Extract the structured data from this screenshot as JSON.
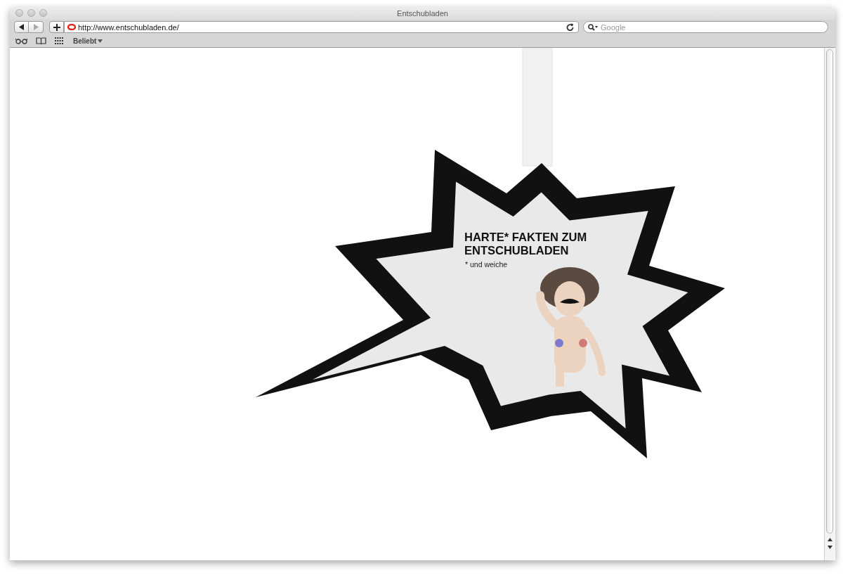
{
  "window": {
    "title": "Entschubladen"
  },
  "nav": [
    {
      "kind": "back",
      "disabled": false
    },
    {
      "kind": "forward",
      "disabled": true
    }
  ],
  "address": {
    "value": "http://www.entschubladen.de/"
  },
  "search": {
    "placeholder": "Google"
  },
  "bookmarks": {
    "items": [
      "Beliebt"
    ]
  },
  "page": {
    "heading": "HARTE* FAKTEN ZUM ENTSCHUBLADEN",
    "note": "* und weiche"
  }
}
